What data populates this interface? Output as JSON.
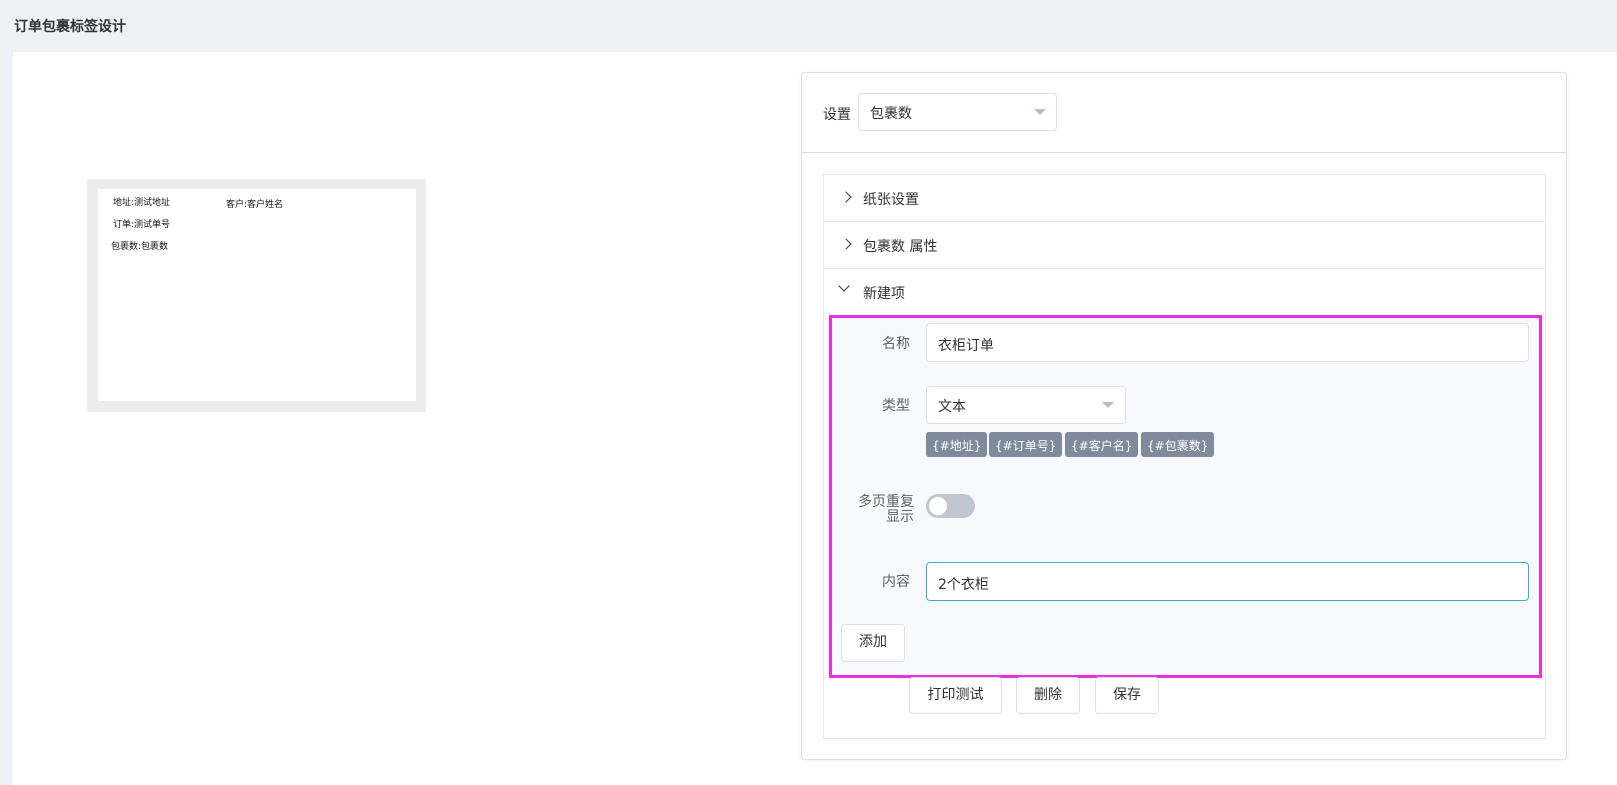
{
  "page": {
    "title": "订单包裹标签设计"
  },
  "label_preview": {
    "address": "地址:测试地址",
    "customer": "客户:客户姓名",
    "order": "订单:测试单号",
    "packages": "包裹数:包裹数"
  },
  "settings": {
    "label": "设置",
    "selected": "包裹数",
    "sections": {
      "paper": "纸张设置",
      "attributes": "包裹数 属性",
      "new_item": "新建项"
    },
    "form": {
      "name_label": "名称",
      "name_value": "衣柜订单",
      "type_label": "类型",
      "type_value": "文本",
      "tags": [
        "{#地址}",
        "{#订单号}",
        "{#客户名}",
        "{#包裹数}"
      ],
      "repeat_label_line1": "多页重复",
      "repeat_label_line2": "显示",
      "repeat_on": false,
      "content_label": "内容",
      "content_value": "2个衣柜",
      "add_button": "添加"
    },
    "actions": {
      "print_test": "打印测试",
      "delete": "删除",
      "save": "保存"
    }
  },
  "colors": {
    "highlight_border": "#e831e0",
    "tag_bg": "#7f8b9c",
    "focus_border": "#3da8d8"
  }
}
